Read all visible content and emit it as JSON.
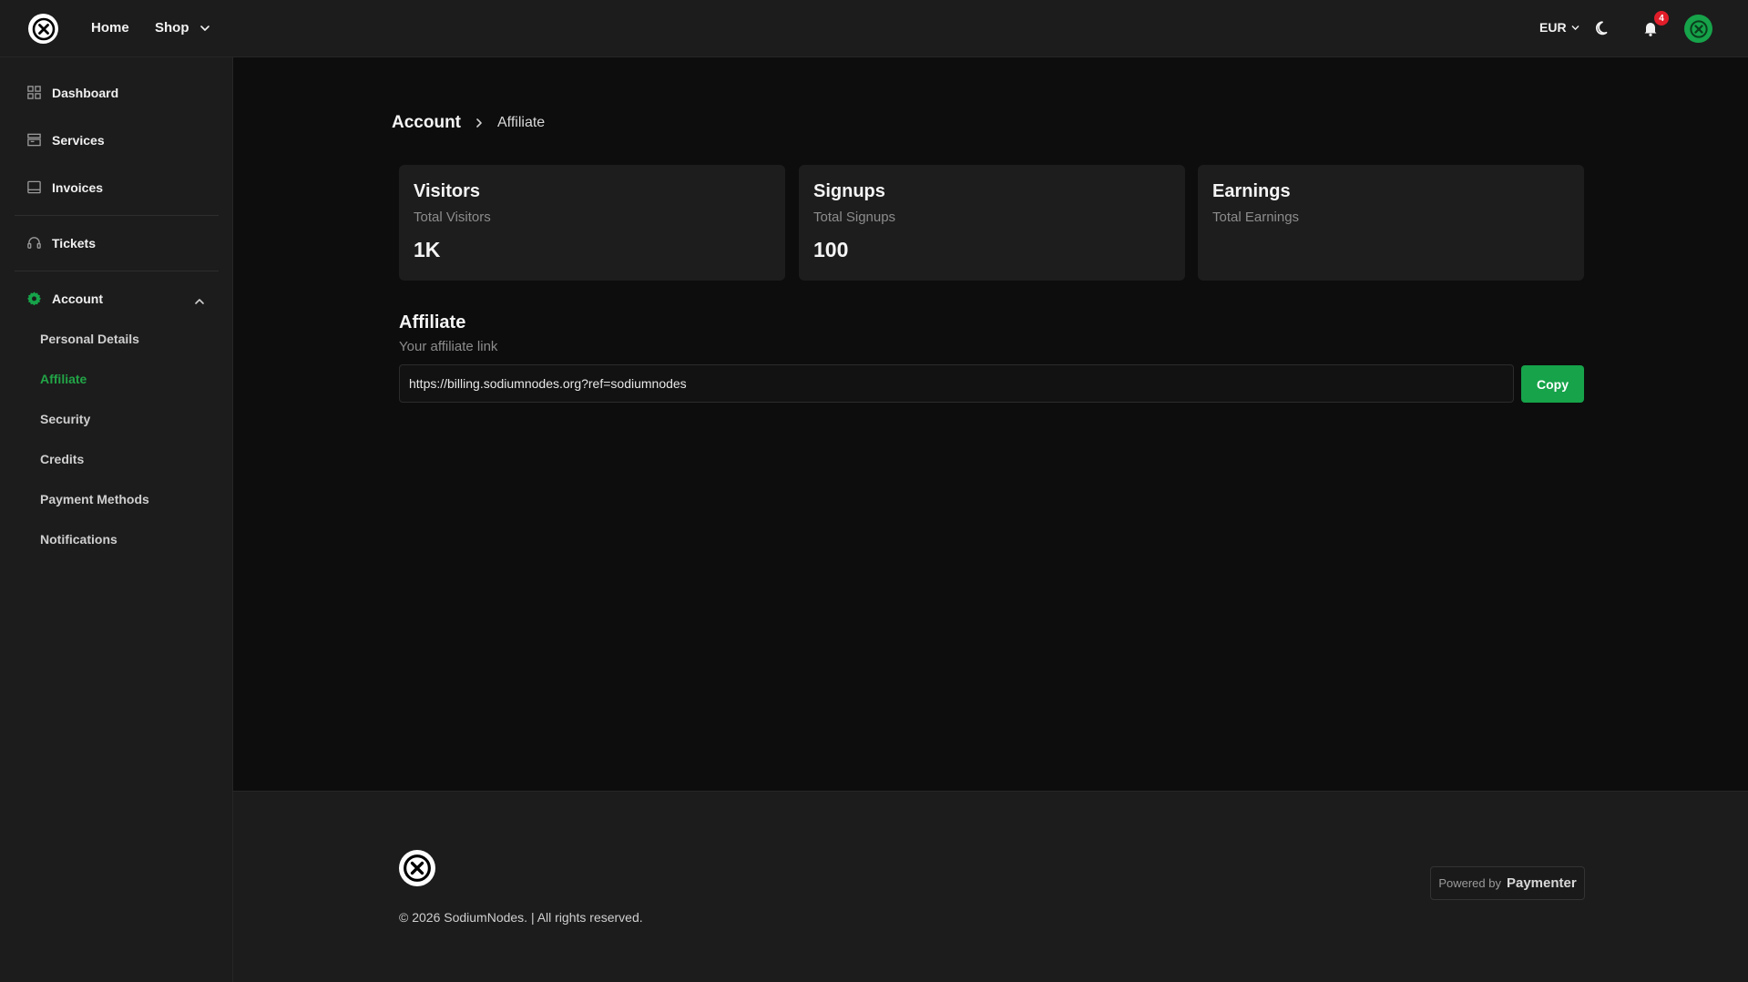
{
  "topbar": {
    "nav": {
      "home": "Home",
      "shop": "Shop"
    },
    "currency": "EUR",
    "notification_count": "4"
  },
  "sidebar": {
    "items": [
      {
        "label": "Dashboard",
        "icon": "dashboard-icon"
      },
      {
        "label": "Services",
        "icon": "server-icon"
      },
      {
        "label": "Invoices",
        "icon": "invoice-icon"
      },
      {
        "label": "Tickets",
        "icon": "headset-icon"
      },
      {
        "label": "Account",
        "icon": "gear-icon",
        "expanded": true
      }
    ],
    "account_sub": [
      {
        "label": "Personal Details"
      },
      {
        "label": "Affiliate",
        "active": true
      },
      {
        "label": "Security"
      },
      {
        "label": "Credits"
      },
      {
        "label": "Payment Methods"
      },
      {
        "label": "Notifications"
      }
    ]
  },
  "breadcrumb": {
    "root": "Account",
    "current": "Affiliate"
  },
  "stats": [
    {
      "title": "Visitors",
      "subtitle": "Total Visitors",
      "value": "1K"
    },
    {
      "title": "Signups",
      "subtitle": "Total Signups",
      "value": "100"
    },
    {
      "title": "Earnings",
      "subtitle": "Total Earnings",
      "value": ""
    }
  ],
  "affiliate": {
    "title": "Affiliate",
    "subtitle": "Your affiliate link",
    "link": "https://billing.sodiumnodes.org?ref=sodiumnodes",
    "copy_label": "Copy"
  },
  "footer": {
    "copyright": "© 2026 SodiumNodes. | All rights reserved.",
    "powered_by": "Powered by",
    "brand": "Paymenter"
  },
  "colors": {
    "accent": "#16a34a",
    "active_link": "#22a447",
    "badge": "#e11d2a"
  }
}
